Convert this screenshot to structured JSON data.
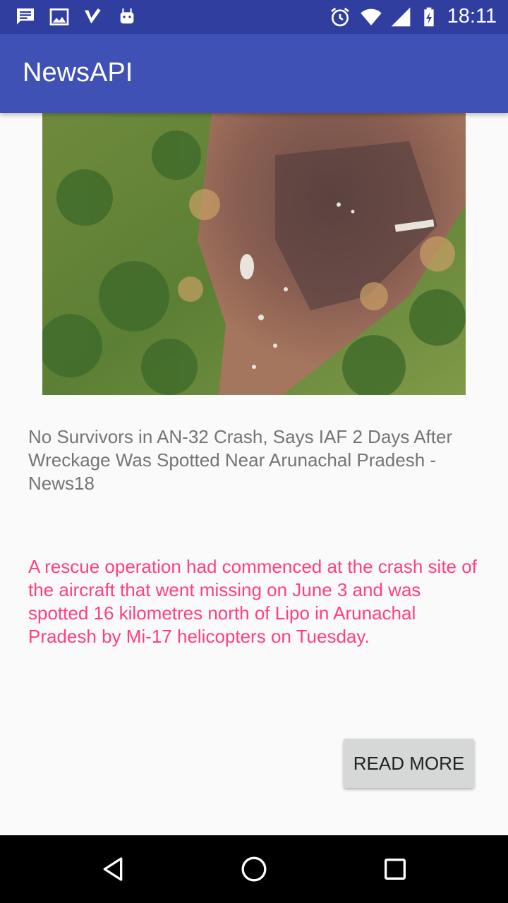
{
  "status_bar": {
    "time": "18:11",
    "left_icons": [
      "message-icon",
      "image-icon",
      "check-icon",
      "android-icon"
    ],
    "right_icons": [
      "alarm-icon",
      "wifi-icon",
      "signal-icon",
      "battery-charging-icon"
    ]
  },
  "app_bar": {
    "title": "NewsAPI"
  },
  "article": {
    "image_description": "aerial photo",
    "headline": "No Survivors in AN-32 Crash, Says IAF 2 Days After Wreckage Was Spotted Near Arunachal Pradesh - News18",
    "description": "A rescue operation had commenced at the crash site of the aircraft that went missing on June 3 and was spotted 16 kilometres north of Lipo in Arunachal Pradesh by Mi-17 helicopters on Tuesday.",
    "read_more_label": "READ MORE"
  },
  "nav_bar": {
    "buttons": [
      "back-icon",
      "home-icon",
      "recents-icon"
    ]
  },
  "colors": {
    "status_bar": "#303f9f",
    "app_bar": "#3f51b5",
    "headline_text": "#757575",
    "description_text": "#ff4081",
    "button_bg": "#d6d7d7"
  }
}
